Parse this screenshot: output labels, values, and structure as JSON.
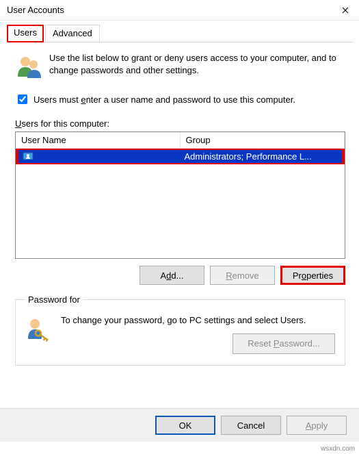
{
  "window": {
    "title": "User Accounts"
  },
  "tabs": {
    "users": "Users",
    "advanced": "Advanced"
  },
  "intro_text": "Use the list below to grant or deny users access to your computer, and to change passwords and other settings.",
  "checkbox_label_pre": "Users must ",
  "checkbox_label_u": "e",
  "checkbox_label_post": "nter a user name and password to use this computer.",
  "users_label_pre": "",
  "users_label_u": "U",
  "users_label_post": "sers for this computer:",
  "columns": {
    "name": "User Name",
    "group": "Group"
  },
  "rows": [
    {
      "username": "",
      "group": "Administrators; Performance L..."
    }
  ],
  "buttons": {
    "add_pre": "A",
    "add_u": "d",
    "add_post": "d...",
    "remove_u": "R",
    "remove_post": "emove",
    "properties_pre": "Pr",
    "properties_u": "o",
    "properties_post": "perties"
  },
  "group": {
    "legend": "Password for",
    "text": "To change your password, go to PC settings and select Users.",
    "reset_pre": "Reset ",
    "reset_u": "P",
    "reset_post": "assword..."
  },
  "bottom": {
    "ok": "OK",
    "cancel": "Cancel",
    "apply_u": "A",
    "apply_post": "pply"
  },
  "watermark": "wsxdn.com"
}
